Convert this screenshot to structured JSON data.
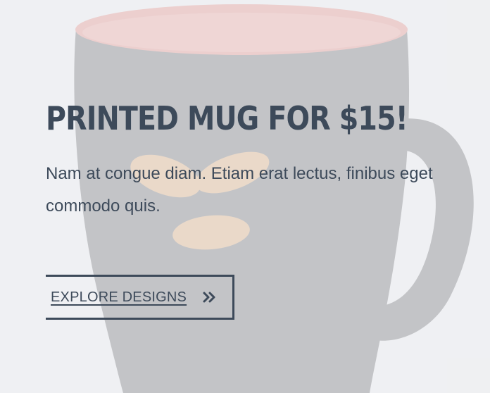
{
  "hero": {
    "headline": "PRINTED MUG FOR $15!",
    "description": "Nam at congue diam. Etiam erat lectus, finibus eget commodo quis.",
    "cta_label": "EXPLORE DESIGNS",
    "cta_icon": "double-chevron-right-icon"
  },
  "colors": {
    "text": "#3d4a5a",
    "mug_body": "#2b2c30",
    "mug_inner": "#e25a4f",
    "logo": "#d8893a"
  }
}
